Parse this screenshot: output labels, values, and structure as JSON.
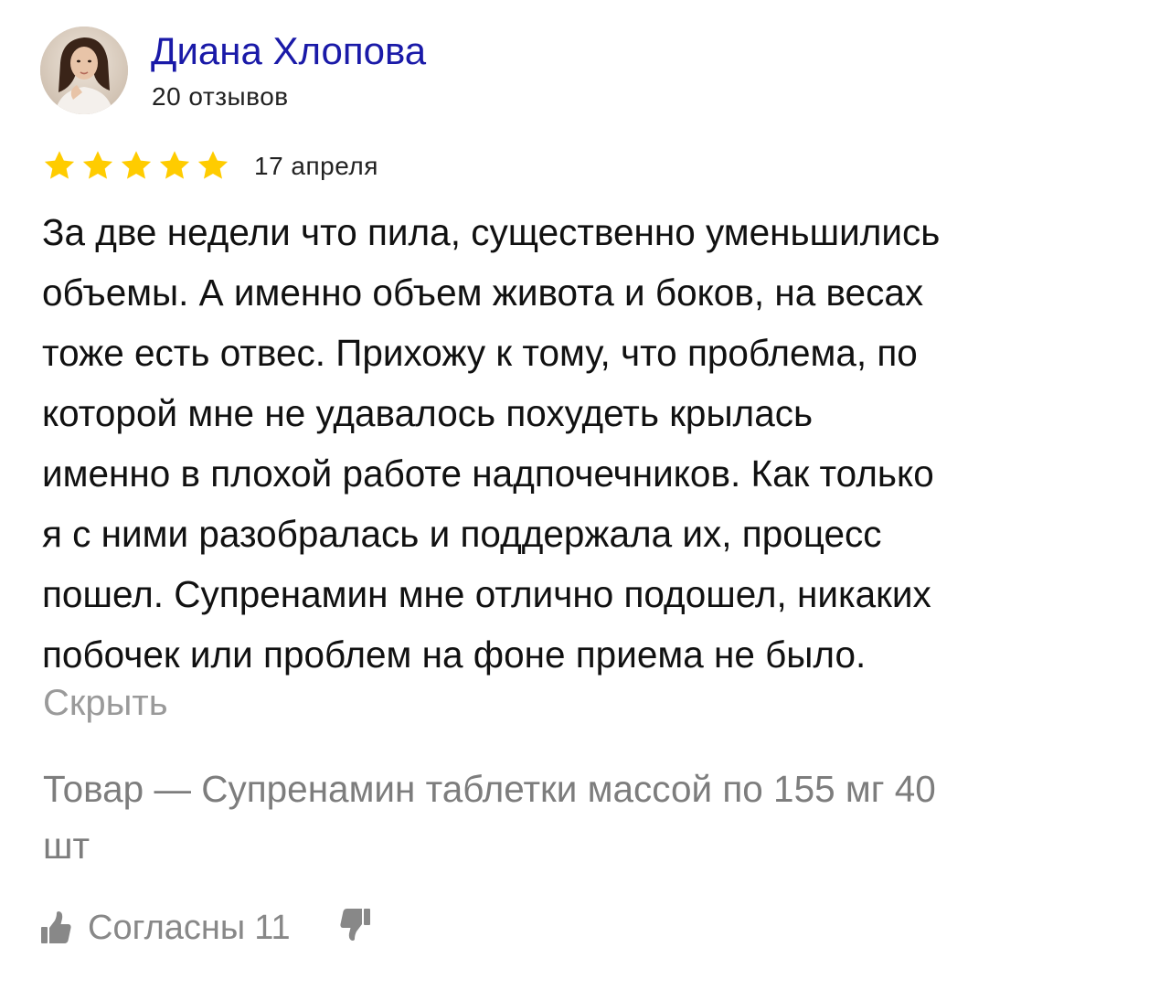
{
  "author": {
    "name": "Диана Хлопова",
    "reviews_count": "20 отзывов"
  },
  "rating": {
    "stars": 5,
    "max_stars": 5,
    "color": "#FFCC00",
    "date": "17 апреля"
  },
  "review": {
    "text_lines": [
      "За две недели что пила, существенно уменьшились",
      "объемы. А именно объем живота и боков, на весах",
      "тоже есть отвес. Прихожу к тому, что проблема, по",
      "которой мне не удавалось похудеть крылась",
      "именно в плохой работе надпочечников. Как только",
      "я с ними разобралась и поддержала их, процесс",
      "пошел. Супренамин мне отлично подошел, никаких",
      "побочек или проблем на фоне приема не было."
    ],
    "hide_label": "Скрыть"
  },
  "product": {
    "lines": [
      "Товар — Супренамин таблетки массой по 155 мг 40",
      "шт"
    ]
  },
  "votes": {
    "agree_label": "Согласны",
    "agree_count": "11",
    "agree_icon": "thumbs-up-icon",
    "disagree_icon": "thumbs-down-icon",
    "icon_color": "#888888"
  },
  "colors": {
    "author_name": "#1a1aa8",
    "muted_text": "#9a9a9a"
  }
}
